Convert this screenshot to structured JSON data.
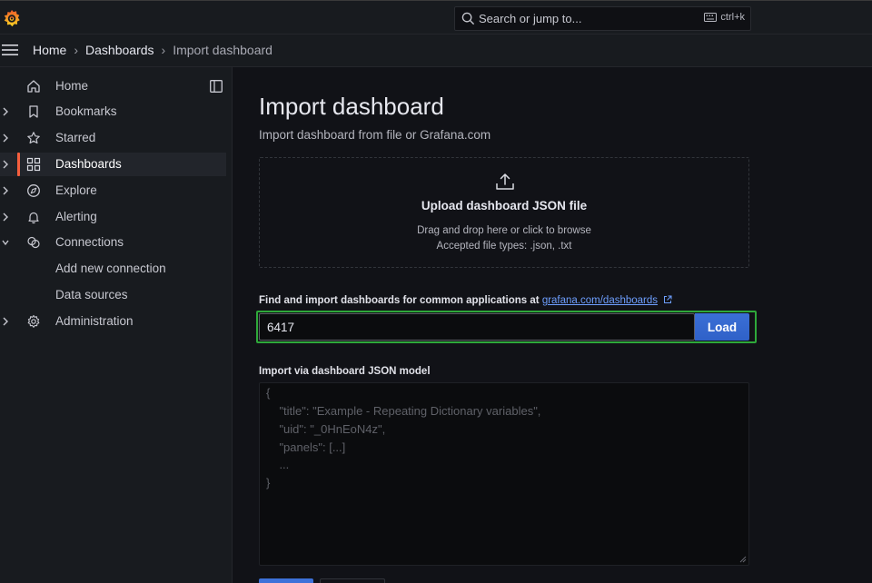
{
  "topbar": {
    "search_placeholder": "Search or jump to...",
    "shortcut": "ctrl+k"
  },
  "breadcrumbs": [
    "Home",
    "Dashboards",
    "Import dashboard"
  ],
  "sidebar": {
    "items": [
      {
        "label": "Home",
        "icon": "home-icon",
        "expandable": false,
        "active": false
      },
      {
        "label": "Bookmarks",
        "icon": "bookmark-icon",
        "expandable": true,
        "active": false
      },
      {
        "label": "Starred",
        "icon": "star-icon",
        "expandable": true,
        "active": false
      },
      {
        "label": "Dashboards",
        "icon": "apps-grid-icon",
        "expandable": true,
        "active": true
      },
      {
        "label": "Explore",
        "icon": "compass-icon",
        "expandable": true,
        "active": false
      },
      {
        "label": "Alerting",
        "icon": "bell-icon",
        "expandable": true,
        "active": false
      },
      {
        "label": "Connections",
        "icon": "connections-icon",
        "expandable": true,
        "expanded": true,
        "active": false
      },
      {
        "label": "Add new connection",
        "icon": "",
        "expandable": false,
        "active": false
      },
      {
        "label": "Data sources",
        "icon": "",
        "expandable": false,
        "active": false
      },
      {
        "label": "Administration",
        "icon": "gear-icon",
        "expandable": true,
        "active": false
      }
    ]
  },
  "main": {
    "title": "Import dashboard",
    "subtitle": "Import dashboard from file or Grafana.com",
    "upload": {
      "title": "Upload dashboard JSON file",
      "hint": "Drag and drop here or click to browse",
      "types": "Accepted file types: .json, .txt"
    },
    "find": {
      "label": "Find and import dashboards for common applications at",
      "link": "grafana.com/dashboards",
      "input_value": "6417",
      "load_label": "Load"
    },
    "json": {
      "label": "Import via dashboard JSON model",
      "placeholder_lines": [
        "{",
        "    \"title\": \"Example - Repeating Dictionary variables\",",
        "    \"uid\": \"_0HnEoN4z\",",
        "    \"panels\": [...]",
        "    ...",
        "}"
      ]
    }
  },
  "colors": {
    "accent": "#f55f3e",
    "primary_button": "#3d71d9",
    "link": "#6e9fff",
    "highlight_border": "#2ea83a"
  }
}
